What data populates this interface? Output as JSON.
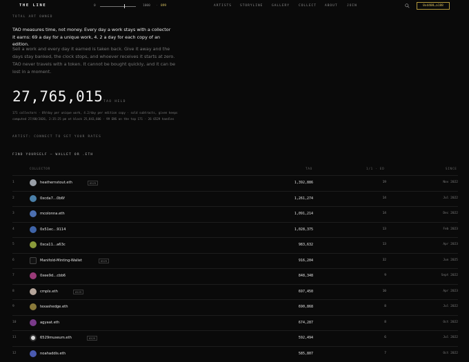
{
  "brand": "THE LINE",
  "slider": {
    "min": "0",
    "max": "1000",
    "sep": "·",
    "value": "899"
  },
  "nav": [
    "ARTISTS",
    "STORYLINE",
    "GALLERY",
    "COLLECT",
    "ABOUT",
    "JOIN"
  ],
  "wallet": "0xd408…a188",
  "section_label": "TOTAL ART OWNED",
  "lead": "TAO measures time, not money. Every day a work stays with a collector it earns: 69 a day for a unique work, 4. 2 a day for each copy of an edition.",
  "paragraph": "Sell a work and every day it earned is taken back. Give it away and the days stay banked, the clock stops, and whoever receives it starts at zero. TAO never travels with a token. It cannot be bought quickly, and it can be lost in a moment.",
  "total": "27,765,015",
  "total_unit": "TAO HELD",
  "stats_line1": "171 collectors · 69/day per unique work, 4.2/day per edition copy · sold subtracts, given keeps",
  "stats_line2": "computed 27/08/2026, 2:35:25 pm at block 25,843,606 · 99 ENS on the top 171 · 26 6529 handles",
  "artist_prompt": "ARTIST: CONNECT TO SET YOUR RATES",
  "find_prompt": "FIND YOURSELF — WALLET OR .ETH",
  "table": {
    "headers": {
      "collector": "COLLECTOR",
      "tao": "TAO",
      "days": "1/1 · ED",
      "since": "SINCE"
    },
    "rows": [
      {
        "rank": "1",
        "name": "heathernstout.eth",
        "badge": "6529",
        "tao": "1,392,886",
        "days": "19",
        "since": "Nov 2022",
        "color": "#9aa0a8"
      },
      {
        "rank": "2",
        "name": "0xcda7…0b6f",
        "badge": "",
        "tao": "1,261,274",
        "days": "14",
        "since": "Jul 2022",
        "color": "#4a7fa8"
      },
      {
        "rank": "3",
        "name": "mcolonna.eth",
        "badge": "",
        "tao": "1,091,214",
        "days": "14",
        "since": "Dec 2022",
        "color": "#4c6fb0"
      },
      {
        "rank": "4",
        "name": "0x51ec…9114",
        "badge": "",
        "tao": "1,028,375",
        "days": "13",
        "since": "Feb 2023",
        "color": "#3f64a8"
      },
      {
        "rank": "5",
        "name": "0xca11…a63c",
        "badge": "",
        "tao": "983,632",
        "days": "13",
        "since": "Apr 2023",
        "color": "#8a9a3a"
      },
      {
        "rank": "6",
        "name": "Manifold-Minting-Wallet",
        "badge": "6529",
        "tao": "916,204",
        "days": "32",
        "since": "Jun 2025",
        "color": "#111111"
      },
      {
        "rank": "7",
        "name": "0xee9d…cbb6",
        "badge": "",
        "tao": "848,348",
        "days": "9",
        "since": "Sept 2022",
        "color": "#9a3a78"
      },
      {
        "rank": "8",
        "name": "cmplx.eth",
        "badge": "6529",
        "tao": "697,450",
        "days": "10",
        "since": "Apr 2023",
        "color": "#b5a59a"
      },
      {
        "rank": "9",
        "name": "texashedge.eth",
        "badge": "",
        "tao": "690,868",
        "days": "8",
        "since": "Jul 2022",
        "color": "#8a7a3a"
      },
      {
        "rank": "10",
        "name": "agyaat.eth",
        "badge": "",
        "tao": "674,287",
        "days": "8",
        "since": "Oct 2022",
        "color": "#7a3a8a"
      },
      {
        "rank": "11",
        "name": "6529museum.eth",
        "badge": "6529",
        "tao": "592,494",
        "days": "6",
        "since": "Jul 2022",
        "color": "#d8d8d8"
      },
      {
        "rank": "12",
        "name": "noahaddis.eth",
        "badge": "",
        "tao": "585,807",
        "days": "7",
        "since": "Oct 2022",
        "color": "#4a5ab0"
      }
    ]
  }
}
